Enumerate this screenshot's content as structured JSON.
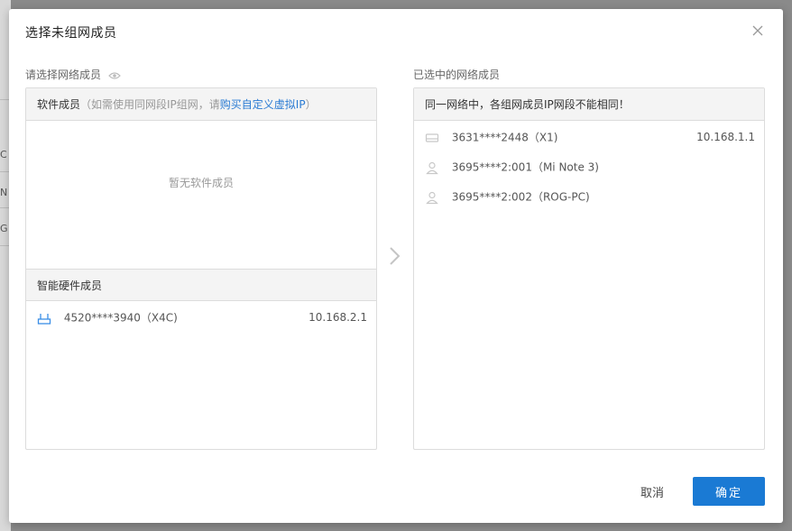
{
  "background": {
    "fragments": [
      "C",
      "N",
      "G"
    ]
  },
  "dialog": {
    "title": "选择未组网成员",
    "close_icon": "close-icon"
  },
  "left": {
    "section_label": "请选择网络成员",
    "eye_icon": "eye-icon",
    "software": {
      "title": "软件成员",
      "hint_prefix": "（如需使用同网段IP组网，请",
      "hint_link": "购买自定义虚拟IP",
      "hint_suffix": "）",
      "empty_text": "暂无软件成员"
    },
    "hardware": {
      "title": "智能硬件成员",
      "items": [
        {
          "icon": "router-icon",
          "name": "4520****3940（X4C)",
          "ip": "10.168.2.1"
        }
      ]
    }
  },
  "transfer_arrow_icon": "chevron-right-icon",
  "right": {
    "section_label": "已选中的网络成员",
    "header": "同一网络中，各组网成员IP网段不能相同！",
    "items": [
      {
        "icon": "device-icon",
        "name": "3631****2448（X1)",
        "ip": "10.168.1.1"
      },
      {
        "icon": "user-icon",
        "name": "3695****2:001（Mi Note 3)",
        "ip": ""
      },
      {
        "icon": "user-icon",
        "name": "3695****2:002（ROG-PC)",
        "ip": ""
      }
    ]
  },
  "footer": {
    "cancel_label": "取消",
    "ok_label": "确定"
  },
  "colors": {
    "primary": "#1a7ad4",
    "link": "#2a7bd3",
    "router_icon": "#3a8ee6",
    "muted": "#999999"
  }
}
